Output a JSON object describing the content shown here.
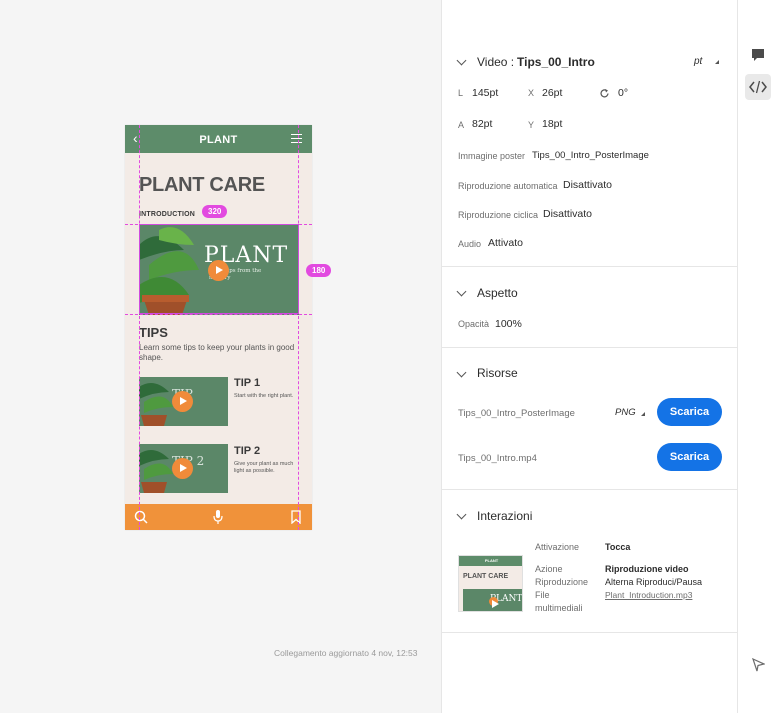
{
  "mock": {
    "header_title": "PLANT",
    "back_glyph": "‹",
    "heading": "PLANT CARE",
    "intro_label": "INTRODUCTION",
    "hero_title": "PLANT",
    "hero_sub": "Plant tips from the nursery",
    "tips_heading": "TIPS",
    "tips_sub": "Learn some tips to keep your plants in good shape.",
    "tips": [
      {
        "title": "TIP 1",
        "desc": "Start with the right plant.",
        "thumb_text": "TIP"
      },
      {
        "title": "TIP 2",
        "desc": "Give your plant as much light as possible.",
        "thumb_text": "TIP 2"
      }
    ],
    "footer_icons": [
      "search-icon",
      "microphone-icon",
      "bookmark-icon"
    ]
  },
  "measure": {
    "width_tag": "320",
    "height_tag": "180"
  },
  "link_note": "Collegamento aggiornato 4 nov, 12:53",
  "panel": {
    "video": {
      "label": "Video :",
      "name": "Tips_00_Intro",
      "unit": "pt",
      "L_label": "L",
      "L": "145pt",
      "X_label": "X",
      "X": "26pt",
      "rot": "0°",
      "A_label": "A",
      "A": "82pt",
      "Y_label": "Y",
      "Y": "18pt",
      "poster_label": "Immagine poster",
      "poster": "Tips_00_Intro_PosterImage",
      "autoplay_label": "Riproduzione automatica",
      "autoplay": "Disattivato",
      "loop_label": "Riproduzione ciclica",
      "loop": "Disattivato",
      "audio_label": "Audio",
      "audio": "Attivato"
    },
    "aspetto": {
      "title": "Aspetto",
      "opacity_label": "Opacità",
      "opacity": "100%"
    },
    "risorse": {
      "title": "Risorse",
      "items": [
        {
          "name": "Tips_00_Intro_PosterImage",
          "format": "PNG",
          "button": "Scarica"
        },
        {
          "name": "Tips_00_Intro.mp4",
          "button": "Scarica"
        }
      ]
    },
    "interazioni": {
      "title": "Interazioni",
      "activation_label": "Attivazione",
      "activation": "Tocca",
      "action_label": "Azione",
      "action": "Riproduzione video",
      "play_label": "Riproduzione",
      "play": "Alterna Riproduci/Pausa",
      "file_label": "File",
      "file_label2": "multimediali",
      "file": "Plant_Introduction.mp3",
      "thumb_header": "PLANT",
      "thumb_heading": "PLANT CARE",
      "thumb_hero": "PLANT"
    }
  },
  "rail": [
    "comment-icon",
    "code-icon",
    "flag-icon"
  ],
  "colors": {
    "accent": "#1473e6",
    "guide": "#e24ae0",
    "plant_green": "#5b8768",
    "orange": "#f0923a"
  }
}
